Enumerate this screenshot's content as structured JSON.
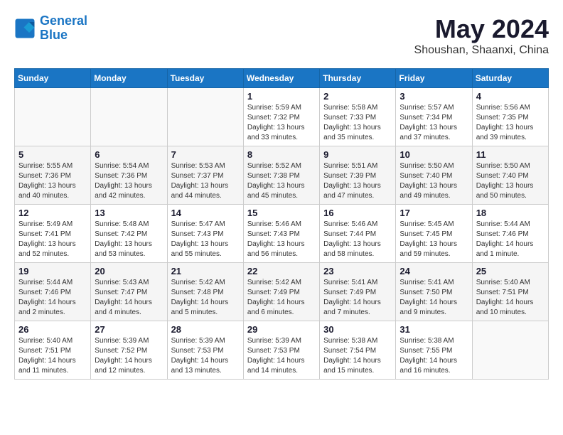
{
  "header": {
    "logo_line1": "General",
    "logo_line2": "Blue",
    "month": "May 2024",
    "location": "Shoushan, Shaanxi, China"
  },
  "days_of_week": [
    "Sunday",
    "Monday",
    "Tuesday",
    "Wednesday",
    "Thursday",
    "Friday",
    "Saturday"
  ],
  "weeks": [
    [
      {
        "day": "",
        "info": ""
      },
      {
        "day": "",
        "info": ""
      },
      {
        "day": "",
        "info": ""
      },
      {
        "day": "1",
        "info": "Sunrise: 5:59 AM\nSunset: 7:32 PM\nDaylight: 13 hours\nand 33 minutes."
      },
      {
        "day": "2",
        "info": "Sunrise: 5:58 AM\nSunset: 7:33 PM\nDaylight: 13 hours\nand 35 minutes."
      },
      {
        "day": "3",
        "info": "Sunrise: 5:57 AM\nSunset: 7:34 PM\nDaylight: 13 hours\nand 37 minutes."
      },
      {
        "day": "4",
        "info": "Sunrise: 5:56 AM\nSunset: 7:35 PM\nDaylight: 13 hours\nand 39 minutes."
      }
    ],
    [
      {
        "day": "5",
        "info": "Sunrise: 5:55 AM\nSunset: 7:36 PM\nDaylight: 13 hours\nand 40 minutes."
      },
      {
        "day": "6",
        "info": "Sunrise: 5:54 AM\nSunset: 7:36 PM\nDaylight: 13 hours\nand 42 minutes."
      },
      {
        "day": "7",
        "info": "Sunrise: 5:53 AM\nSunset: 7:37 PM\nDaylight: 13 hours\nand 44 minutes."
      },
      {
        "day": "8",
        "info": "Sunrise: 5:52 AM\nSunset: 7:38 PM\nDaylight: 13 hours\nand 45 minutes."
      },
      {
        "day": "9",
        "info": "Sunrise: 5:51 AM\nSunset: 7:39 PM\nDaylight: 13 hours\nand 47 minutes."
      },
      {
        "day": "10",
        "info": "Sunrise: 5:50 AM\nSunset: 7:40 PM\nDaylight: 13 hours\nand 49 minutes."
      },
      {
        "day": "11",
        "info": "Sunrise: 5:50 AM\nSunset: 7:40 PM\nDaylight: 13 hours\nand 50 minutes."
      }
    ],
    [
      {
        "day": "12",
        "info": "Sunrise: 5:49 AM\nSunset: 7:41 PM\nDaylight: 13 hours\nand 52 minutes."
      },
      {
        "day": "13",
        "info": "Sunrise: 5:48 AM\nSunset: 7:42 PM\nDaylight: 13 hours\nand 53 minutes."
      },
      {
        "day": "14",
        "info": "Sunrise: 5:47 AM\nSunset: 7:43 PM\nDaylight: 13 hours\nand 55 minutes."
      },
      {
        "day": "15",
        "info": "Sunrise: 5:46 AM\nSunset: 7:43 PM\nDaylight: 13 hours\nand 56 minutes."
      },
      {
        "day": "16",
        "info": "Sunrise: 5:46 AM\nSunset: 7:44 PM\nDaylight: 13 hours\nand 58 minutes."
      },
      {
        "day": "17",
        "info": "Sunrise: 5:45 AM\nSunset: 7:45 PM\nDaylight: 13 hours\nand 59 minutes."
      },
      {
        "day": "18",
        "info": "Sunrise: 5:44 AM\nSunset: 7:46 PM\nDaylight: 14 hours\nand 1 minute."
      }
    ],
    [
      {
        "day": "19",
        "info": "Sunrise: 5:44 AM\nSunset: 7:46 PM\nDaylight: 14 hours\nand 2 minutes."
      },
      {
        "day": "20",
        "info": "Sunrise: 5:43 AM\nSunset: 7:47 PM\nDaylight: 14 hours\nand 4 minutes."
      },
      {
        "day": "21",
        "info": "Sunrise: 5:42 AM\nSunset: 7:48 PM\nDaylight: 14 hours\nand 5 minutes."
      },
      {
        "day": "22",
        "info": "Sunrise: 5:42 AM\nSunset: 7:49 PM\nDaylight: 14 hours\nand 6 minutes."
      },
      {
        "day": "23",
        "info": "Sunrise: 5:41 AM\nSunset: 7:49 PM\nDaylight: 14 hours\nand 7 minutes."
      },
      {
        "day": "24",
        "info": "Sunrise: 5:41 AM\nSunset: 7:50 PM\nDaylight: 14 hours\nand 9 minutes."
      },
      {
        "day": "25",
        "info": "Sunrise: 5:40 AM\nSunset: 7:51 PM\nDaylight: 14 hours\nand 10 minutes."
      }
    ],
    [
      {
        "day": "26",
        "info": "Sunrise: 5:40 AM\nSunset: 7:51 PM\nDaylight: 14 hours\nand 11 minutes."
      },
      {
        "day": "27",
        "info": "Sunrise: 5:39 AM\nSunset: 7:52 PM\nDaylight: 14 hours\nand 12 minutes."
      },
      {
        "day": "28",
        "info": "Sunrise: 5:39 AM\nSunset: 7:53 PM\nDaylight: 14 hours\nand 13 minutes."
      },
      {
        "day": "29",
        "info": "Sunrise: 5:39 AM\nSunset: 7:53 PM\nDaylight: 14 hours\nand 14 minutes."
      },
      {
        "day": "30",
        "info": "Sunrise: 5:38 AM\nSunset: 7:54 PM\nDaylight: 14 hours\nand 15 minutes."
      },
      {
        "day": "31",
        "info": "Sunrise: 5:38 AM\nSunset: 7:55 PM\nDaylight: 14 hours\nand 16 minutes."
      },
      {
        "day": "",
        "info": ""
      }
    ]
  ]
}
